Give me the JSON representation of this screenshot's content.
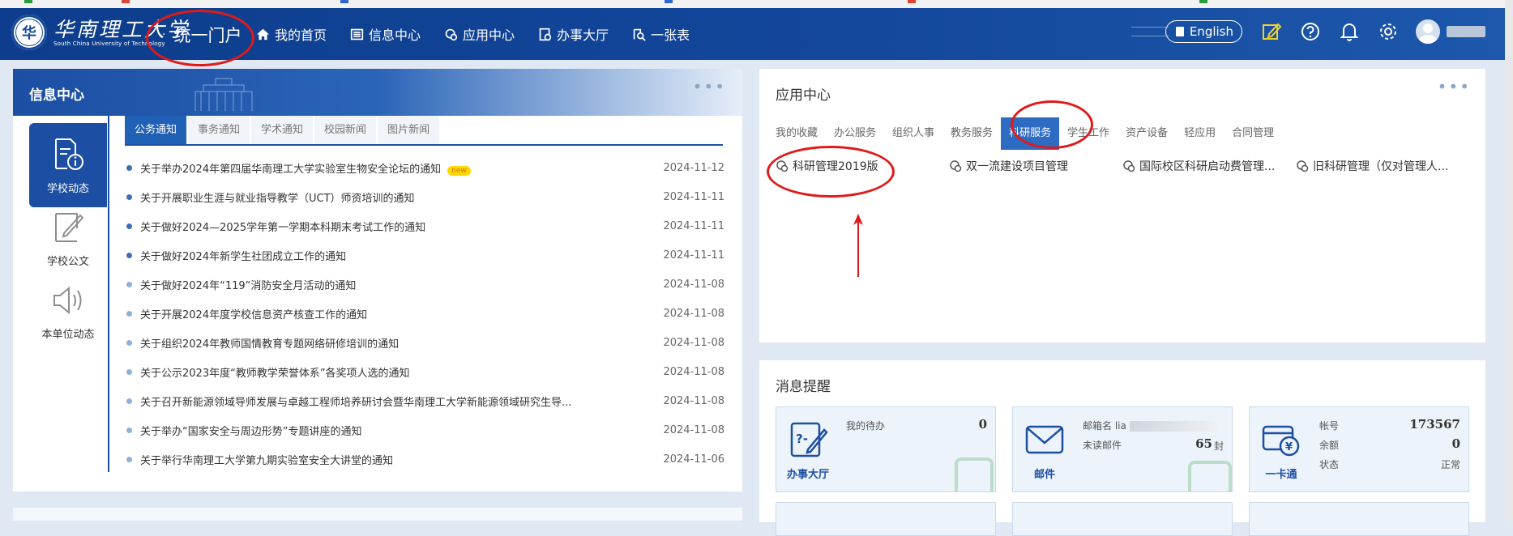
{
  "header": {
    "logo_cn": "华南理工大学",
    "logo_en": "South China University of Technology",
    "portal": "统一门户",
    "nav": [
      "我的首页",
      "信息中心",
      "应用中心",
      "办事大厅",
      "一张表"
    ],
    "english": "English"
  },
  "info": {
    "title": "信息中心",
    "categories": [
      "学校动态",
      "学校公文",
      "本单位动态"
    ],
    "tabs": [
      "公务通知",
      "事务通知",
      "学术通知",
      "校园新闻",
      "图片新闻"
    ],
    "new_badge": "new",
    "news": [
      {
        "title": "关于举办2024年第四届华南理工大学实验室生物安全论坛的通知",
        "date": "2024-11-12"
      },
      {
        "title": "关于开展职业生涯与就业指导教学（UCT）师资培训的通知",
        "date": "2024-11-11"
      },
      {
        "title": "关于做好2024—2025学年第一学期本科期末考试工作的通知",
        "date": "2024-11-11"
      },
      {
        "title": "关于做好2024年新学生社团成立工作的通知",
        "date": "2024-11-11"
      },
      {
        "title": "关于做好2024年“119”消防安全月活动的通知",
        "date": "2024-11-08"
      },
      {
        "title": "关于开展2024年度学校信息资产核查工作的通知",
        "date": "2024-11-08"
      },
      {
        "title": "关于组织2024年教师国情教育专题网络研修培训的通知",
        "date": "2024-11-08"
      },
      {
        "title": "关于公示2023年度“教师教学荣誉体系”各奖项人选的通知",
        "date": "2024-11-08"
      },
      {
        "title": "关于召开新能源领域导师发展与卓越工程师培养研讨会暨华南理工大学新能源领域研究生导...",
        "date": "2024-11-08"
      },
      {
        "title": "关于举办“国家安全与周边形势”专题讲座的通知",
        "date": "2024-11-08"
      },
      {
        "title": "关于举行华南理工大学第九期实验室安全大讲堂的通知",
        "date": "2024-11-06"
      }
    ]
  },
  "app": {
    "title": "应用中心",
    "tabs": [
      "我的收藏",
      "办公服务",
      "组织人事",
      "教务服务",
      "科研服务",
      "学生工作",
      "资产设备",
      "轻应用",
      "合同管理"
    ],
    "items": [
      "科研管理2019版",
      "双一流建设项目管理",
      "国际校区科研启动费管理...",
      "旧科研管理（仅对管理人..."
    ]
  },
  "msg": {
    "title": "消息提醒",
    "todo": {
      "label": "办事大厅",
      "line1": "我的待办",
      "value": "0"
    },
    "mail": {
      "label": "邮件",
      "line1": "邮箱名",
      "prefix": "lia",
      "line2": "未读邮件",
      "count": "65",
      "unit": "封"
    },
    "card": {
      "label": "一卡通",
      "account_label": "帐号",
      "account": "173567",
      "balance_label": "余额",
      "balance": "0",
      "status_label": "状态",
      "status": "正常"
    }
  },
  "colors": {
    "header": "#13479b",
    "accent": "#1c4fa3",
    "annotation": "#e01a1a"
  }
}
